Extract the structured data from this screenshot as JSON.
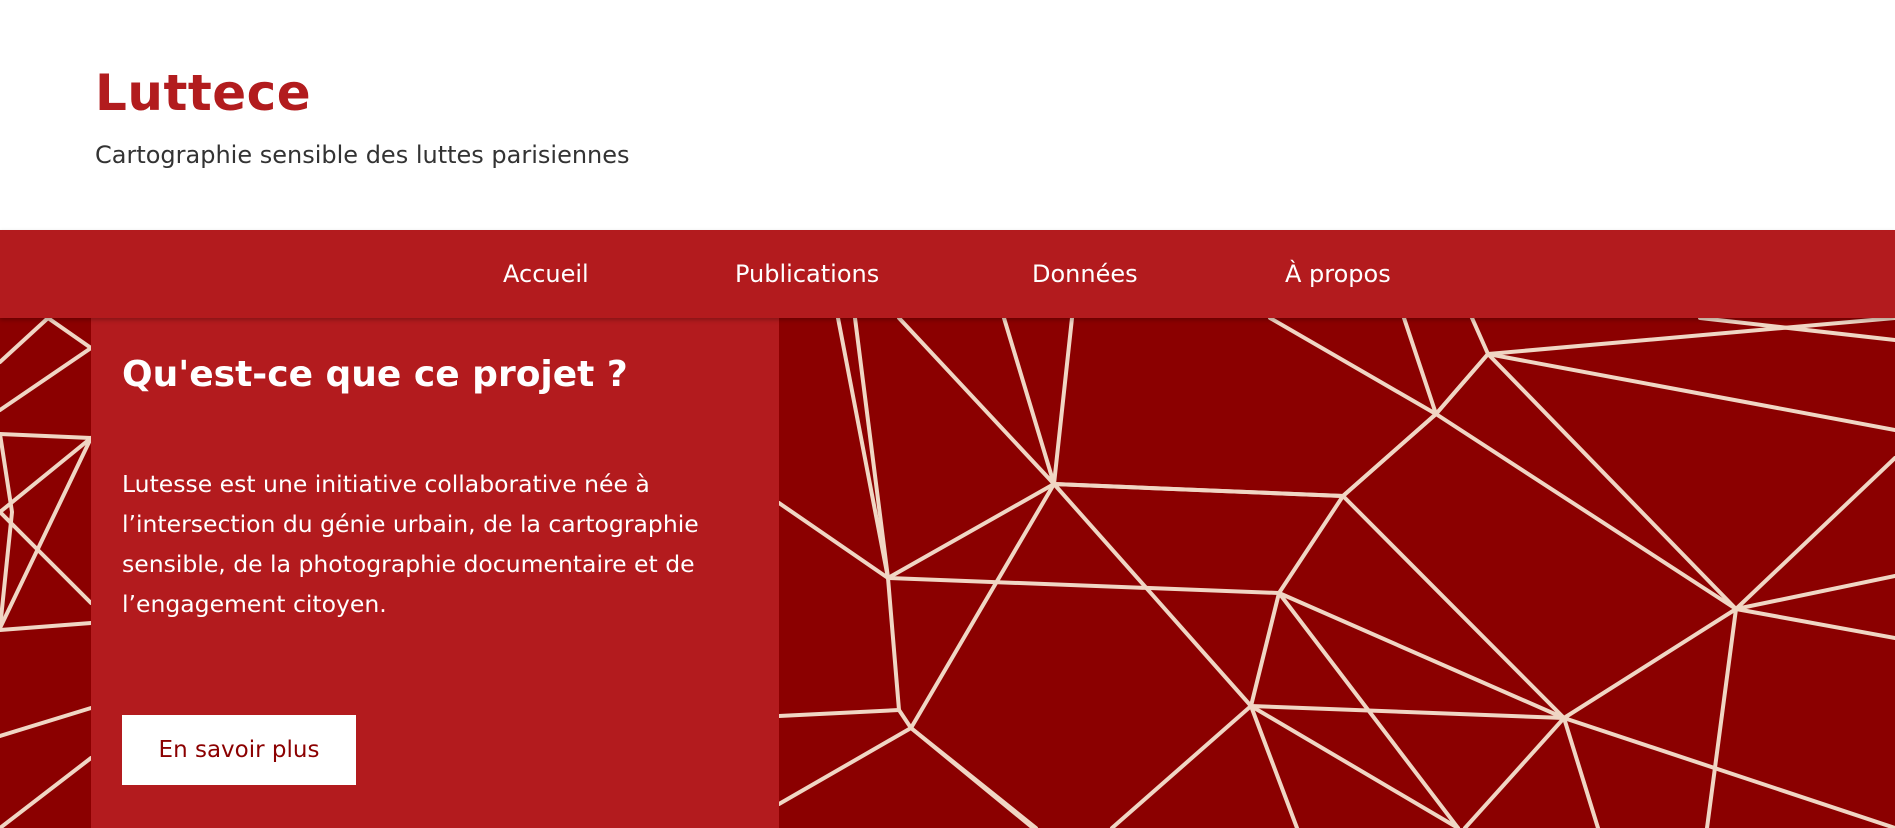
{
  "site": {
    "title": "Luttece",
    "tagline": "Cartographie sensible des luttes parisiennes"
  },
  "nav": {
    "items": [
      {
        "label": "Accueil"
      },
      {
        "label": "Publications"
      },
      {
        "label": "Données"
      },
      {
        "label": "À propos"
      }
    ]
  },
  "hero": {
    "title": "Qu'est-ce que ce projet ?",
    "body": "Lutesse est une initiative collaborative née à l’intersection du génie urbain, de la cartographie sensible, de la photographie documentaire et de l’engagement citoyen.",
    "button_label": "En savoir plus"
  },
  "colors": {
    "brand_red": "#b31b1e",
    "dark_red": "#8b0000",
    "line_cream": "#f0d6c4",
    "header_bg": "#ffffff"
  }
}
